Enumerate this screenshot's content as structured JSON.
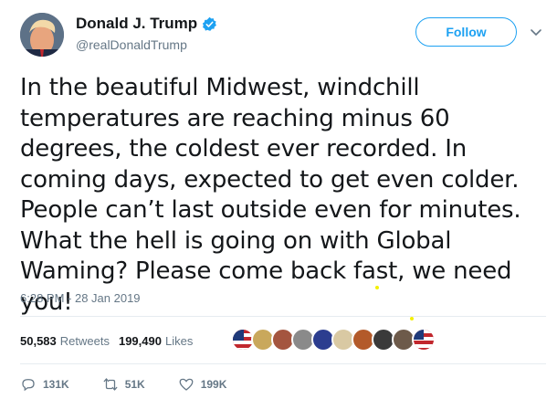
{
  "user": {
    "name": "Donald J. Trump",
    "handle": "@realDonaldTrump"
  },
  "follow_label": "Follow",
  "tweet": {
    "part1": "In the beautiful Midwest, windchill temperatures are reaching minus 60 degrees, the coldest ever recorded. In coming days, expected to get even colder. People can’t last outside even for minutes. What the hell is going on with ",
    "highlight1": "Global Waming",
    "part2": "? Please come back fast, ",
    "highlight2": "we need you",
    "part3": "!"
  },
  "timestamp": "6:28 PM - 28 Jan 2019",
  "stats": {
    "retweets_count": "50,583",
    "retweets_label": "Retweets",
    "likes_count": "199,490",
    "likes_label": "Likes"
  },
  "actions": {
    "replies": "131K",
    "retweets": "51K",
    "likes": "199K"
  },
  "colors": {
    "accent": "#1da1f2",
    "highlight": "#f4f000",
    "muted": "#657786"
  }
}
